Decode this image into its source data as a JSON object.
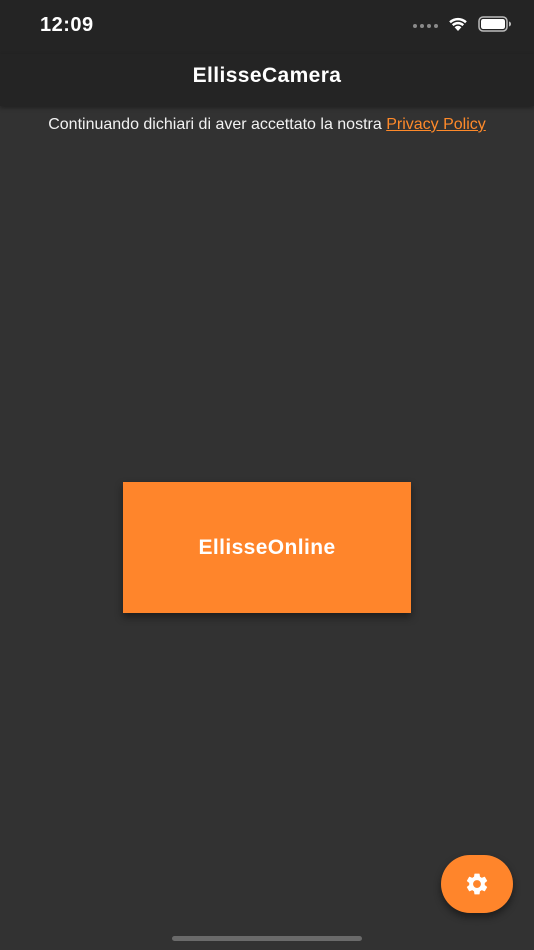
{
  "status_bar": {
    "time": "12:09",
    "icons": [
      "cellular-dots-icon",
      "wifi-icon",
      "battery-icon"
    ]
  },
  "nav_bar": {
    "title": "EllisseCamera"
  },
  "privacy": {
    "text": "Continuando dichiari di aver accettato la nostra ",
    "link_label": "Privacy Policy"
  },
  "main": {
    "button_label": "EllisseOnline"
  },
  "fab": {
    "icon": "gear-icon"
  },
  "colors": {
    "background": "#323232",
    "bar": "#242424",
    "accent": "#ff852b",
    "link": "#ff8a2a"
  }
}
